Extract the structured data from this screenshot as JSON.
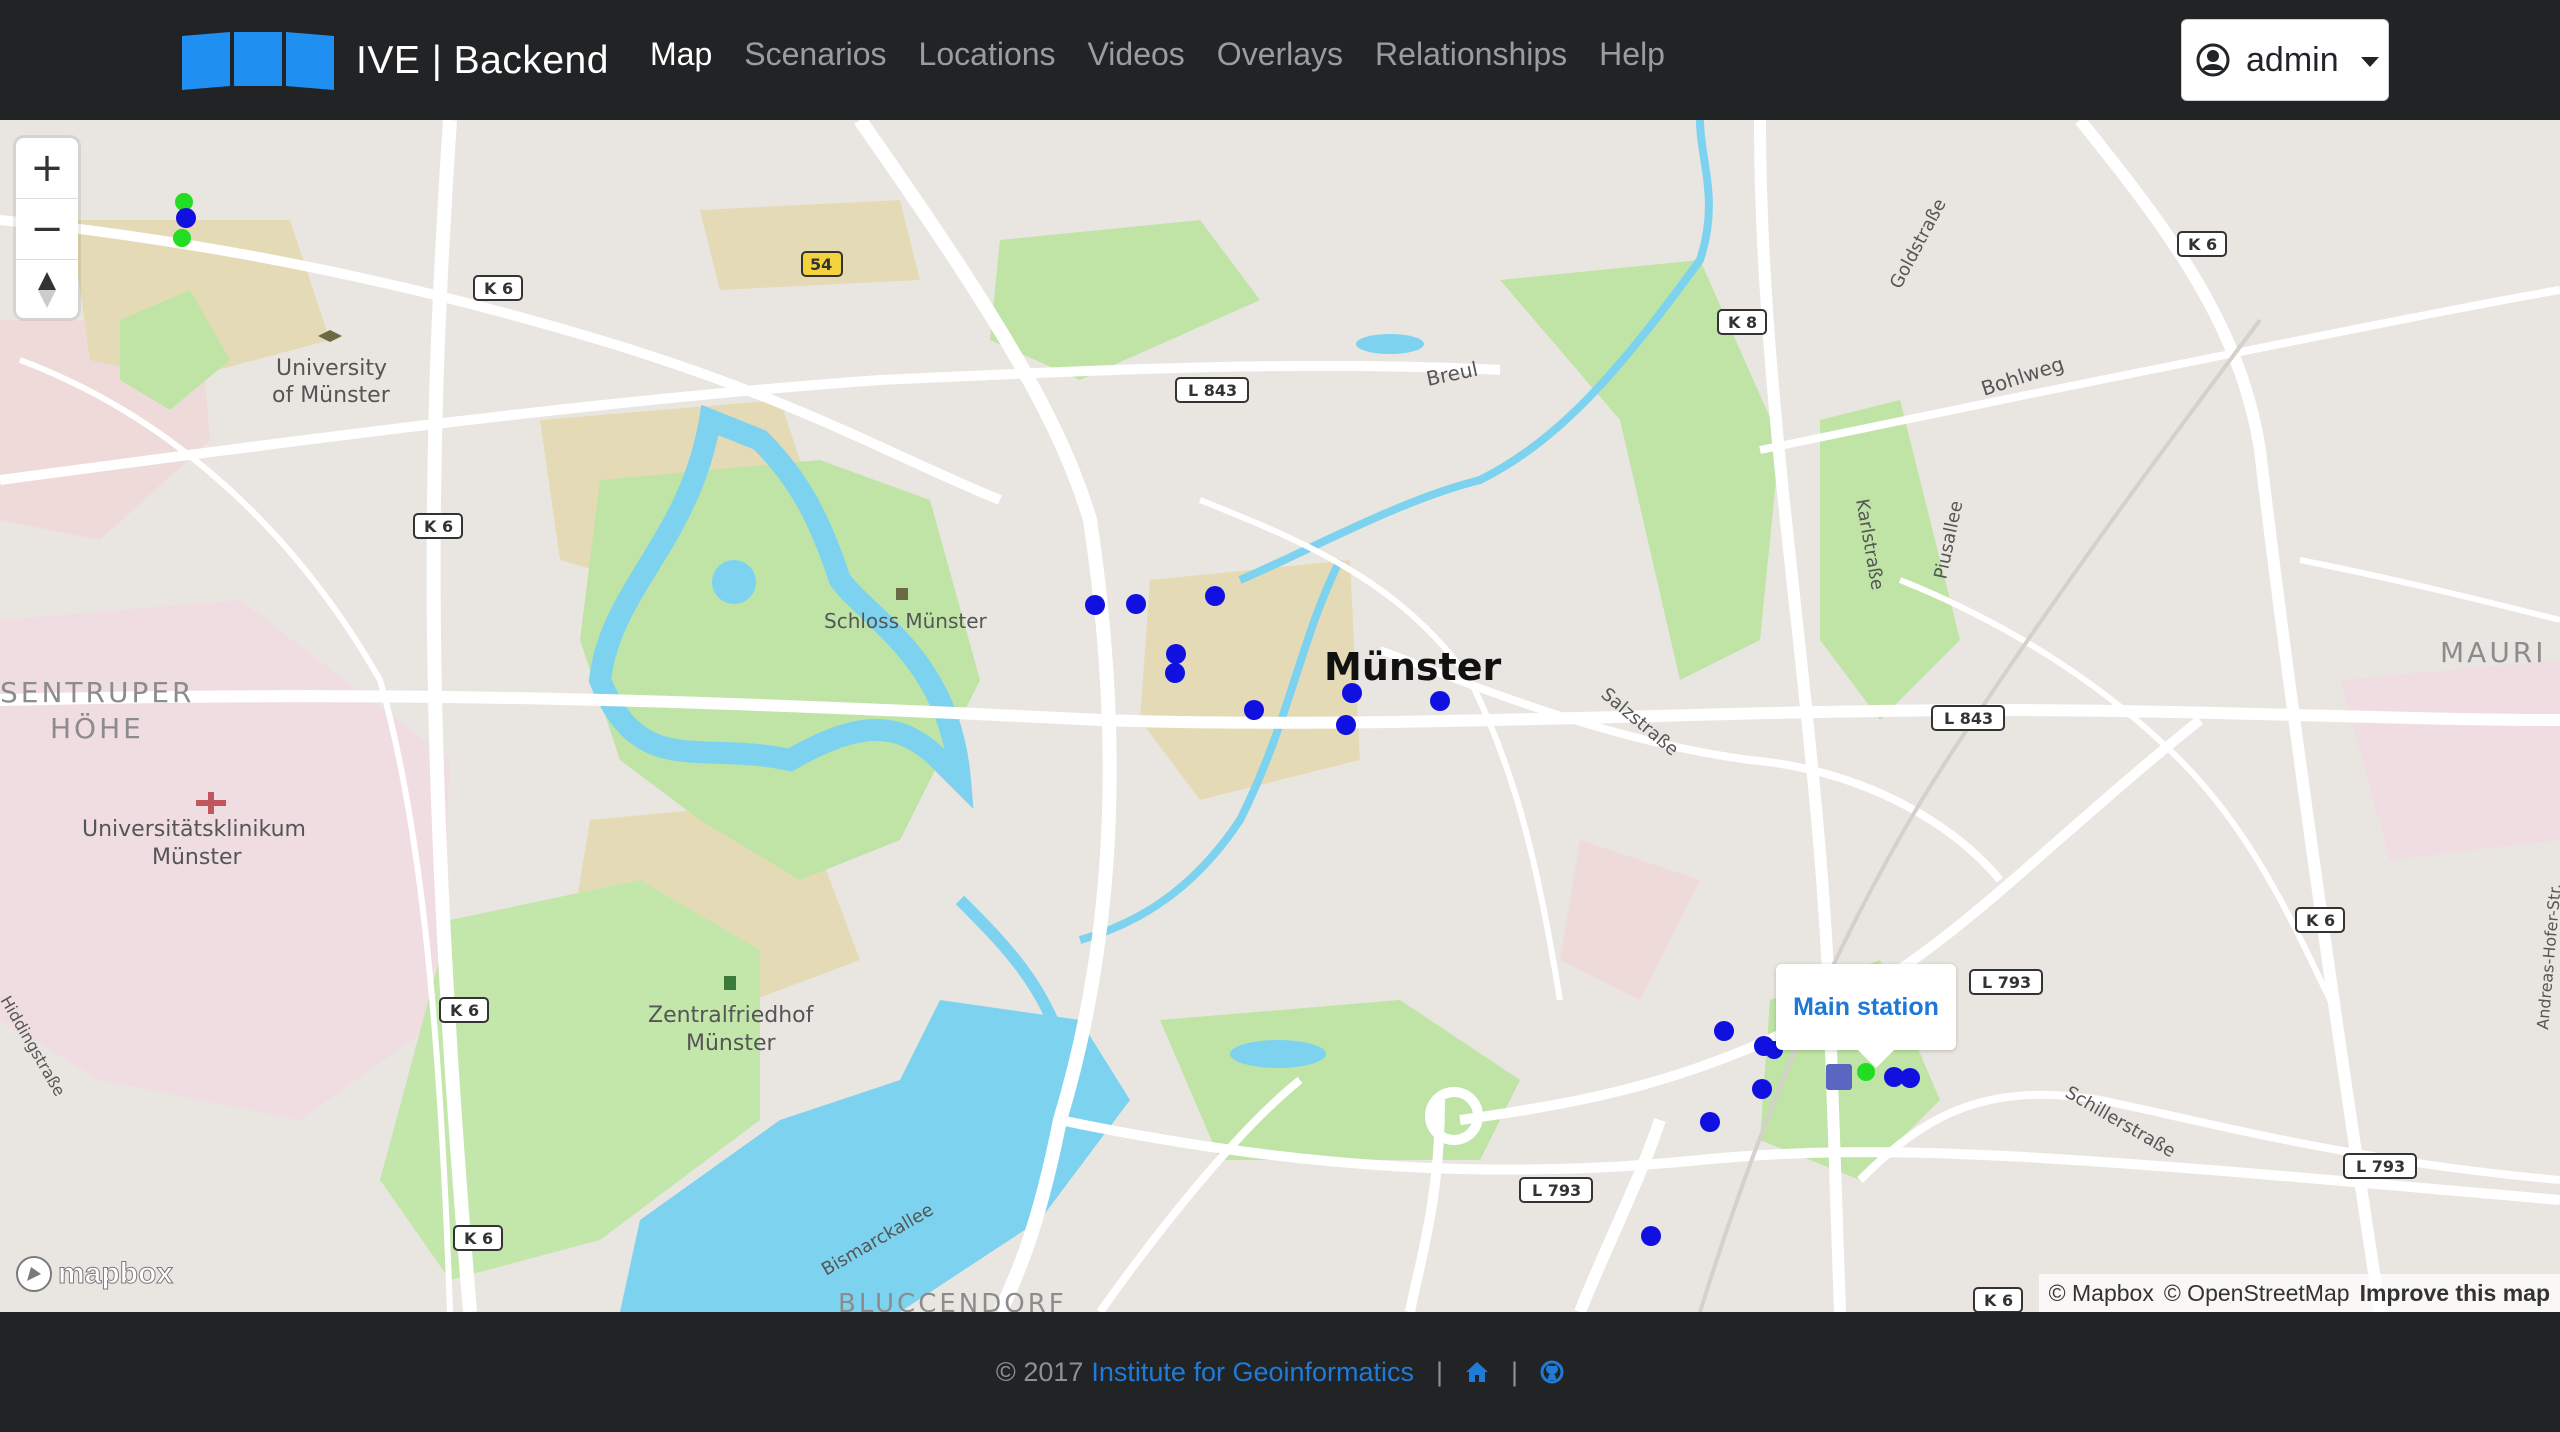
{
  "navbar": {
    "brand": "IVE | Backend",
    "links": [
      {
        "label": "Map",
        "active": true
      },
      {
        "label": "Scenarios",
        "active": false
      },
      {
        "label": "Locations",
        "active": false
      },
      {
        "label": "Videos",
        "active": false
      },
      {
        "label": "Overlays",
        "active": false
      },
      {
        "label": "Relationships",
        "active": false
      },
      {
        "label": "Help",
        "active": false
      }
    ],
    "user": "admin"
  },
  "map": {
    "controls": {
      "zoom_in": "+",
      "zoom_out": "−",
      "compass": "north-arrow-icon"
    },
    "city_label": "Münster",
    "place_labels": [
      "University",
      "of Münster",
      "Schloss Münster",
      "SENTRUPER",
      "HÖHE",
      "Universitätsklinikum",
      "Münster",
      "Zentralfriedhof",
      "Münster",
      "BLUCCENDORF",
      "MAURI"
    ],
    "street_labels": [
      "Breul",
      "Bohlweg",
      "Goldstraße",
      "Karlstraße",
      "Piusallee",
      "Salzstraße",
      "Schillerstraße",
      "Bismarckallee",
      "Andreas-Hofer-Str.",
      "Hiddingstraße"
    ],
    "road_shields": [
      "K 6",
      "54",
      "L 843",
      "K 8",
      "L 793"
    ],
    "popup": "Main station",
    "attribution": {
      "mapbox": "© Mapbox",
      "osm": "© OpenStreetMap",
      "improve": "Improve this map"
    },
    "logo": "mapbox",
    "marker_colors": {
      "location": "#1010e0",
      "selected": "#22dd22",
      "water": "#7dd3ef",
      "park": "#bfe4a5"
    }
  },
  "footer": {
    "copyright": "© 2017",
    "institute": "Institute for Geoinformatics",
    "home_icon": "home-icon",
    "github_icon": "github-icon"
  }
}
